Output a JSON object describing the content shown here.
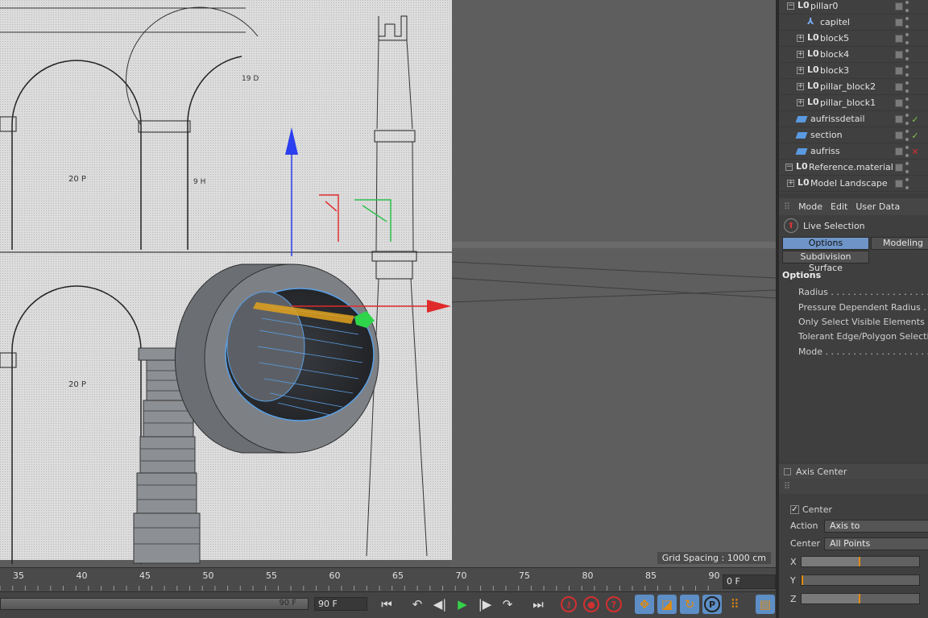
{
  "viewport": {
    "grid_spacing": "Grid Spacing : 1000 cm"
  },
  "timeline": {
    "ticks": [
      "35",
      "40",
      "45",
      "50",
      "55",
      "60",
      "65",
      "70",
      "75",
      "80",
      "85",
      "90"
    ],
    "current_frame": "0 F",
    "range_end_label": "90 F",
    "range_end_field": "90 F"
  },
  "objects": [
    {
      "name": "pillar0",
      "level": 0,
      "icon": "null-object-icon",
      "expand": "minus",
      "tag": ""
    },
    {
      "name": "capitel",
      "level": 1,
      "icon": "axis-object-icon",
      "expand": "",
      "tag": ""
    },
    {
      "name": "block5",
      "level": 1,
      "icon": "null-object-icon",
      "expand": "plus",
      "tag": ""
    },
    {
      "name": "block4",
      "level": 1,
      "icon": "null-object-icon",
      "expand": "plus",
      "tag": ""
    },
    {
      "name": "block3",
      "level": 1,
      "icon": "null-object-icon",
      "expand": "plus",
      "tag": ""
    },
    {
      "name": "pillar_block2",
      "level": 1,
      "icon": "null-object-icon",
      "expand": "plus",
      "tag": ""
    },
    {
      "name": "pillar_block1",
      "level": 1,
      "icon": "null-object-icon",
      "expand": "plus",
      "tag": ""
    },
    {
      "name": "aufrissdetail",
      "level": 0,
      "icon": "plane-object-icon",
      "expand": "",
      "tag": "✓"
    },
    {
      "name": "section",
      "level": 0,
      "icon": "plane-object-icon",
      "expand": "",
      "tag": "✓"
    },
    {
      "name": "aufriss",
      "level": 0,
      "icon": "plane-object-icon",
      "expand": "",
      "tag": "✕"
    },
    {
      "name": "Reference.material",
      "level": -1,
      "icon": "null-object-icon",
      "expand": "minus",
      "tag": ""
    },
    {
      "name": "Model Landscape",
      "level": 0,
      "icon": "null-object-icon",
      "expand": "plus",
      "tag": ""
    }
  ],
  "attributes": {
    "menu": [
      "Mode",
      "Edit",
      "User Data"
    ],
    "tool_name": "Live Selection",
    "tabs": [
      "Options",
      "Modeling"
    ],
    "subtab": "Subdivision Surface",
    "section_title": "Options",
    "options": [
      "Radius . . . . . . . . . . . . . . . . . .",
      "Pressure Dependent Radius . . .",
      "Only Select Visible Elements . .",
      "Tolerant Edge/Polygon Selection",
      "Mode . . . . . . . . . . . . . . . . . . ."
    ]
  },
  "axis_center": {
    "title": "Axis Center",
    "center_checkbox": "Center",
    "action_label": "Action",
    "action_value": "Axis to",
    "center_label": "Center",
    "center_value": "All Points",
    "sliders": [
      {
        "label": "X",
        "value": 0.5
      },
      {
        "label": "Y",
        "value": 0.0
      },
      {
        "label": "Z",
        "value": 0.5
      }
    ]
  },
  "colors": {
    "accent": "#5d8ec6",
    "slider_marker": "#e38b10",
    "tag_check": "#7ec850",
    "tag_cross": "#d23030"
  }
}
